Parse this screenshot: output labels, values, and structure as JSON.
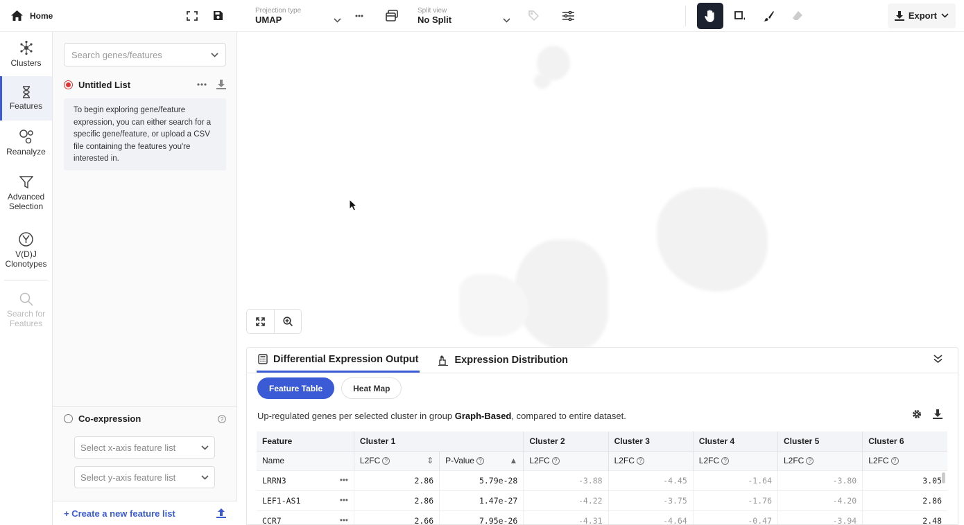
{
  "home": {
    "label": "Home"
  },
  "rail": {
    "clusters": "Clusters",
    "features": "Features",
    "reanalyze": "Reanalyze",
    "advanced_line1": "Advanced",
    "advanced_line2": "Selection",
    "vdj_line1": "V(D)J",
    "vdj_line2": "Clonotypes",
    "search_line1": "Search for",
    "search_line2": "Features"
  },
  "panel": {
    "search_placeholder": "Search genes/features",
    "list_title": "Untitled List",
    "hint": "To begin exploring gene/feature expression, you can either search for a specific gene/feature, or upload a CSV file containing the features you're interested in.",
    "coexp_title": "Co-expression",
    "x_placeholder": "Select x-axis feature list",
    "y_placeholder": "Select y-axis feature list",
    "new_list": "+ Create a new feature list"
  },
  "toolbar": {
    "projection_label": "Projection type",
    "projection_value": "UMAP",
    "split_label": "Split view",
    "split_value": "No Split",
    "export": "Export"
  },
  "bottom": {
    "tab1": "Differential Expression Output",
    "tab2": "Expression Distribution",
    "pill1": "Feature Table",
    "pill2": "Heat Map",
    "caption_pre": "Up-regulated genes per selected cluster in group ",
    "caption_bold": "Graph-Based",
    "caption_post": ", compared to entire dataset.",
    "headers": [
      "Feature",
      "Cluster 1",
      "Cluster 2",
      "Cluster 3",
      "Cluster 4",
      "Cluster 5",
      "Cluster 6"
    ],
    "sub_name": "Name",
    "sub_l2fc": "L2FC",
    "sub_pvalue": "P-Value",
    "rows": [
      {
        "name": "LRRN3",
        "c1_l2fc": "2.86",
        "c1_p": "5.79e-28",
        "c2": "-3.88",
        "c3": "-4.45",
        "c4": "-1.64",
        "c5": "-3.80",
        "c6": "3.05"
      },
      {
        "name": "LEF1-AS1",
        "c1_l2fc": "2.86",
        "c1_p": "1.47e-27",
        "c2": "-4.22",
        "c3": "-3.75",
        "c4": "-1.76",
        "c5": "-4.20",
        "c6": "2.86"
      },
      {
        "name": "CCR7",
        "c1_l2fc": "2.66",
        "c1_p": "7.95e-26",
        "c2": "-4.31",
        "c3": "-4.64",
        "c4": "-0.47",
        "c5": "-3.94",
        "c6": "2.48"
      }
    ]
  },
  "colors": {
    "accent": "#3b5bd6",
    "active_tool": "#1d2230",
    "list_dot": "#d33333"
  }
}
